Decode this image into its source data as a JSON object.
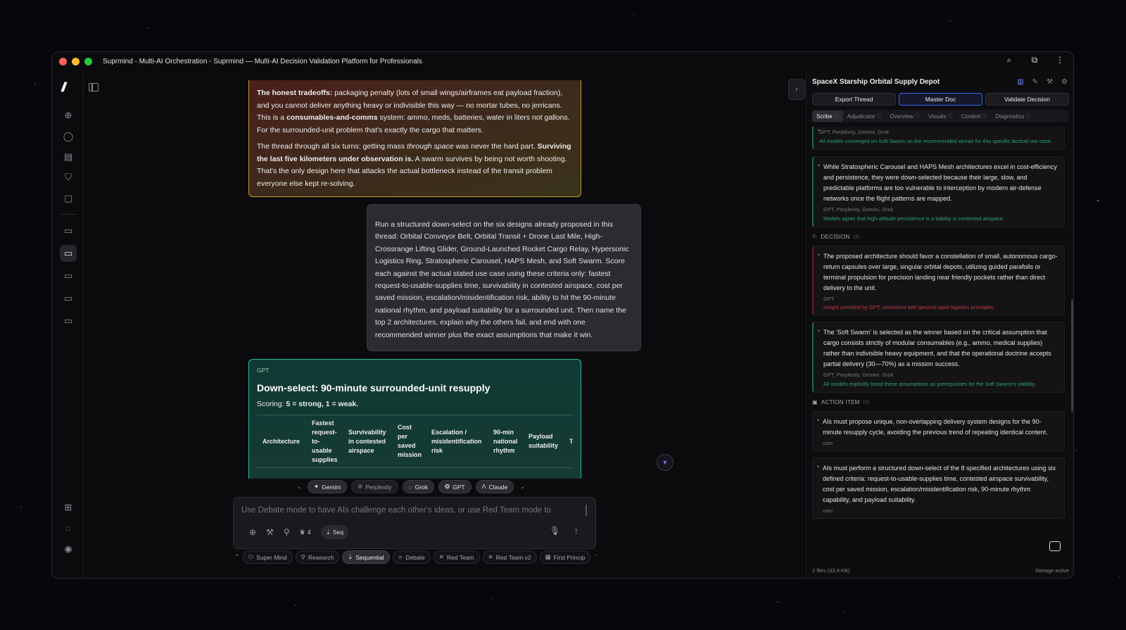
{
  "window": {
    "title": "Suprmind - Multi-AI Orchestration - Suprmind — Multi-AI Decision Validation Platform for Professionals",
    "actions": [
      "search-icon",
      "extension-icon",
      "more-vert-icon"
    ]
  },
  "left_rail": {
    "logo": "//",
    "icons": [
      "new-chat-icon",
      "chat-icon",
      "notes-icon",
      "shield-icon",
      "document-icon",
      "folder-icon",
      "folder-icon",
      "folder-icon",
      "folder-icon",
      "folder-icon",
      "grid-icon",
      "message-icon",
      "user-circle-icon"
    ]
  },
  "chat": {
    "orange_message": {
      "p1_bold1": "The honest tradeoffs:",
      "p1_text1": " packaging penalty (lots of small wings/airframes eat payload fraction), and you cannot deliver anything heavy or indivisible this way — no mortar tubes, no jerricans. This is a ",
      "p1_bold2": "consumables-and-comms",
      "p1_text2": " system: ammo, meds, batteries, water in liters not gallons. For the surrounded-unit problem that's exactly the cargo that matters.",
      "p2_text1": "The thread through all six turns: getting mass ",
      "p2_italic": "through space",
      "p2_text2": " was never the hard part. ",
      "p2_bold": "Surviving the last five kilometers under observation is.",
      "p2_text3": " A swarm survives by being not worth shooting. That's the only design here that attacks the actual bottleneck instead of the transit problem everyone else kept re-solving."
    },
    "user_message": "Run a structured down-select on the six designs already proposed in this thread: Orbital Conveyor Belt, Orbital Transit + Drone Last Mile, High-Crossrange Lifting Glider, Ground-Launched Rocket Cargo Relay, Hypersonic Logistics Ring, Stratospheric Carousel, HAPS Mesh, and Soft Swarm. Score each against the actual stated use case using these criteria only: fastest request-to-usable-supplies time, survivability in contested airspace, cost per saved mission, escalation/misidentification risk, ability to hit the 90-minute national rhythm, and payload suitability for a surrounded unit. Then name the top 2 architectures, explain why the others fail, and end with one recommended winner plus the exact assumptions that make it win.",
    "gpt_message": {
      "label": "GPT",
      "title": "Down-select: 90-minute surrounded-unit resupply",
      "scoring_prefix": "Scoring: ",
      "scoring_bold": "5 = strong, 1 = weak.",
      "table_headers": [
        "Architecture",
        "Fastest request-to-usable supplies",
        "Survivability in contested airspace",
        "Cost per saved mission",
        "Escalation / misidentification risk",
        "90-min national rhythm",
        "Payload suitability",
        "T"
      ]
    }
  },
  "models": [
    {
      "label": "Gemini",
      "icon": "✦",
      "on": true
    },
    {
      "label": "Perplexity",
      "icon": "※",
      "on": false
    },
    {
      "label": "Grok",
      "icon": "◌",
      "on": true
    },
    {
      "label": "GPT",
      "icon": "❂",
      "on": true
    },
    {
      "label": "Claude",
      "icon": "ᐱ",
      "on": true
    }
  ],
  "composer": {
    "placeholder": "Use Debate mode to have AIs challenge each other's ideas, or use Red Team mode to",
    "count": "4",
    "seq_label": "Seq"
  },
  "modes": [
    {
      "label": "Super Mind",
      "icon": "⚇",
      "on": false
    },
    {
      "label": "Research",
      "icon": "⚲",
      "on": false
    },
    {
      "label": "Sequential",
      "icon": "⇣",
      "on": true
    },
    {
      "label": "Debate",
      "icon": "⌯",
      "on": false
    },
    {
      "label": "Red Team",
      "icon": "✕",
      "on": false
    },
    {
      "label": "Red Team v2",
      "icon": "✕",
      "on": false
    },
    {
      "label": "First Princip",
      "icon": "▦",
      "on": false
    }
  ],
  "right_panel": {
    "title": "SpaceX Starship Orbital Supply Depot",
    "buttons": {
      "export": "Export Thread",
      "master": "Master Doc",
      "validate": "Validate Decision"
    },
    "tabs": [
      "Scribe",
      "Adjudicator",
      "Overview",
      "Visuals",
      "Context",
      "Diagnostics"
    ],
    "top_card": {
      "src": "GPT, Perplexity, Gemini, Grok",
      "note": "All models converged on Soft Swarm as the recommended winner for this specific tactical use case."
    },
    "card2": {
      "text": "While Stratospheric Carousel and HAPS Mesh architectures excel in cost-efficiency and persistence, they were down-selected because their large, slow, and predictable platforms are too vulnerable to interception by modern air-defense networks once the flight patterns are mapped.",
      "src": "GPT, Perplexity, Gemini, Grok",
      "note": "Models agree that high-altitude persistence is a liability in contested airspace."
    },
    "decision_section": {
      "label": "DECISION",
      "count": "(2)"
    },
    "decision1": {
      "text": "The proposed architecture should favor a constellation of small, autonomous cargo-return capsules over large, singular orbital depots, utilizing guided parafoils or terminal propulsion for precision landing near friendly pockets rather than direct delivery to the unit.",
      "src": "GPT",
      "note": "Insight provided by GPT, consistent with general rapid logistics principles."
    },
    "decision2": {
      "text": "The 'Soft Swarm' is selected as the winner based on the critical assumption that cargo consists strictly of modular consumables (e.g., ammo, medical supplies) rather than indivisible heavy equipment, and that the operational doctrine accepts partial delivery (30—70%) as a mission success.",
      "src": "GPT, Perplexity, Gemini, Grok",
      "note": "All models explicitly listed these assumptions as prerequisites for the Soft Swarm's viability."
    },
    "action_section": {
      "label": "ACTION ITEM",
      "count": "(2)"
    },
    "action1": {
      "text": "AIs must propose unique, non-overlapping delivery system designs for the 90-minute resupply cycle, avoiding the previous trend of repeating identical content.",
      "src": "user"
    },
    "action2": {
      "text": "AIs must perform a structured down-select of the 8 specified architectures using six defined criteria: request-to-usable-supplies time, contested airspace survivability, cost per saved mission, escalation/misidentification risk, 90-minute rhythm capability, and payload suitability.",
      "src": "user"
    },
    "footer": {
      "files": "2 files (33.9 KB)",
      "storage": "Storage active"
    }
  }
}
